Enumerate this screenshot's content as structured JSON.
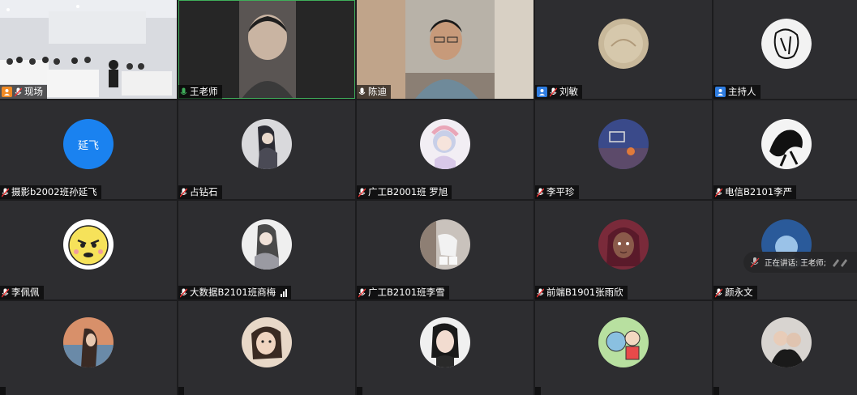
{
  "tiles": [
    {
      "name": "现场",
      "badge": "orange"
    },
    {
      "name": "王老师",
      "active": true
    },
    {
      "name": "陈迪"
    },
    {
      "name": "刘敏",
      "badge": "blue"
    },
    {
      "name": "主持人",
      "badge": "blue",
      "no_mic": true
    },
    {
      "name": "摄影b2002班孙延飞",
      "avatar_text": "延飞"
    },
    {
      "name": "占钻石"
    },
    {
      "name": "广工B2001班 罗旭"
    },
    {
      "name": "李平珍"
    },
    {
      "name": "电信B2101李严"
    },
    {
      "name": "李佩佩"
    },
    {
      "name": "大数据B2101班商梅",
      "signal": true
    },
    {
      "name": "广工B2101班李雪"
    },
    {
      "name": "前端B1901张雨欣"
    },
    {
      "name": "颜永文"
    },
    {
      "name": ""
    },
    {
      "name": ""
    },
    {
      "name": ""
    },
    {
      "name": ""
    },
    {
      "name": ""
    }
  ],
  "speaking_indicator": "正在讲话: 王老师;",
  "colors": {
    "active_border": "#3fae5a",
    "badge_orange": "#f08a24",
    "badge_blue": "#2f7de1",
    "avatar_blue": "#1a82f0"
  }
}
